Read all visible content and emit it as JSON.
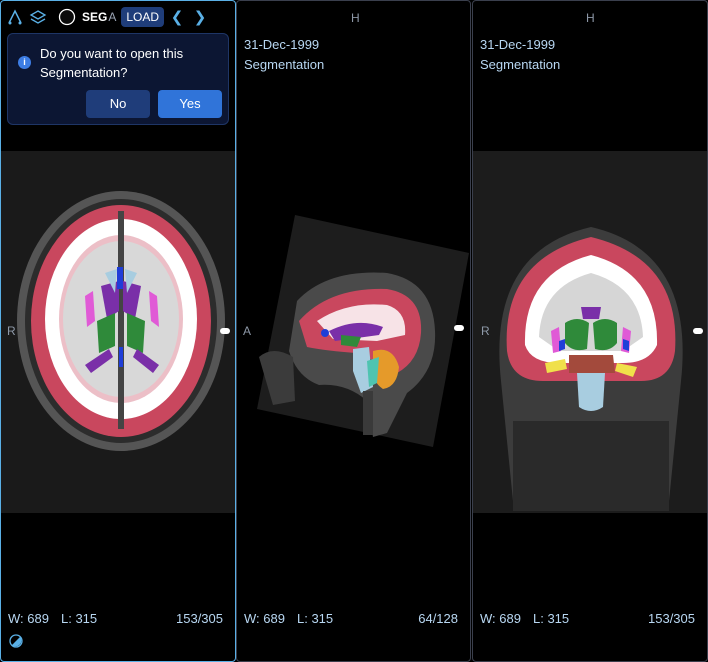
{
  "toolbar": {
    "seg_text": "SEG",
    "seg_extra": "A",
    "load_label": "LOAD",
    "icons": [
      "segmentation-tool-icon",
      "layers-icon",
      "segment-circle-icon",
      "chevron-left-icon",
      "chevron-right-icon"
    ]
  },
  "dialog": {
    "message": "Do you want to open this Segmentation?",
    "no_label": "No",
    "yes_label": "Yes",
    "info_glyph": "i"
  },
  "viewports": [
    {
      "id": "axial",
      "left_marker": "R",
      "top_marker": "",
      "date": "",
      "series": "",
      "window": "W: 689",
      "level": "L: 315",
      "slice": "153/305",
      "active": true
    },
    {
      "id": "sagittal",
      "left_marker": "A",
      "top_marker": "H",
      "date": "31-Dec-1999",
      "series": "Segmentation",
      "window": "W: 689",
      "level": "L: 315",
      "slice": "64/128",
      "active": false
    },
    {
      "id": "coronal",
      "left_marker": "R",
      "top_marker": "H",
      "date": "31-Dec-1999",
      "series": "Segmentation",
      "window": "W: 689",
      "level": "L: 315",
      "slice": "153/305",
      "active": false
    }
  ],
  "colors": {
    "active_border": "#5ab0e6",
    "gray_matter": "#c9475e",
    "white_matter": "#ffffff",
    "ventricle": "#7a2fa8",
    "thalamus": "#2f8a3a",
    "putamen": "#e05ad6",
    "brainstem": "#a8cde0",
    "cerebellum": "#e59a2a",
    "accent": "#3074d9"
  }
}
